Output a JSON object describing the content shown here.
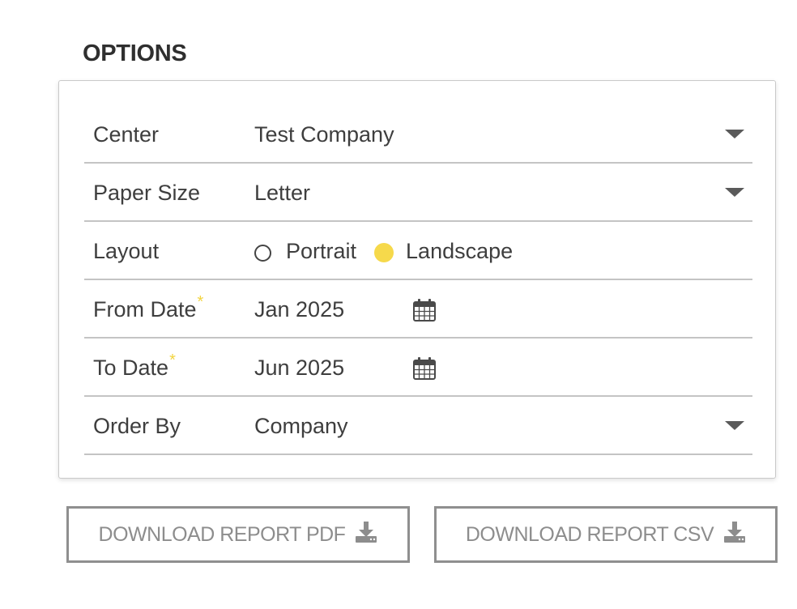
{
  "section": {
    "title": "OPTIONS"
  },
  "form": {
    "center": {
      "label": "Center",
      "value": "Test Company",
      "icon": "chevron-down-icon"
    },
    "paper_size": {
      "label": "Paper Size",
      "value": "Letter",
      "icon": "chevron-down-icon"
    },
    "layout": {
      "label": "Layout",
      "options": [
        "Portrait",
        "Landscape"
      ],
      "selected": "Landscape"
    },
    "from_date": {
      "label": "From Date",
      "required_mark": "*",
      "value": "Jan 2025",
      "icon": "calendar-icon"
    },
    "to_date": {
      "label": "To Date",
      "required_mark": "*",
      "value": "Jun 2025",
      "icon": "calendar-icon"
    },
    "order_by": {
      "label": "Order By",
      "value": "Company",
      "icon": "chevron-down-icon"
    }
  },
  "actions": {
    "pdf_label": "DOWNLOAD REPORT PDF",
    "csv_label": "DOWNLOAD REPORT CSV",
    "icon": "download-icon"
  },
  "colors": {
    "accent": "#f6d94b",
    "required": "#f2d43f",
    "button_text": "#8d8d8d",
    "divider": "#c4c4c4"
  }
}
